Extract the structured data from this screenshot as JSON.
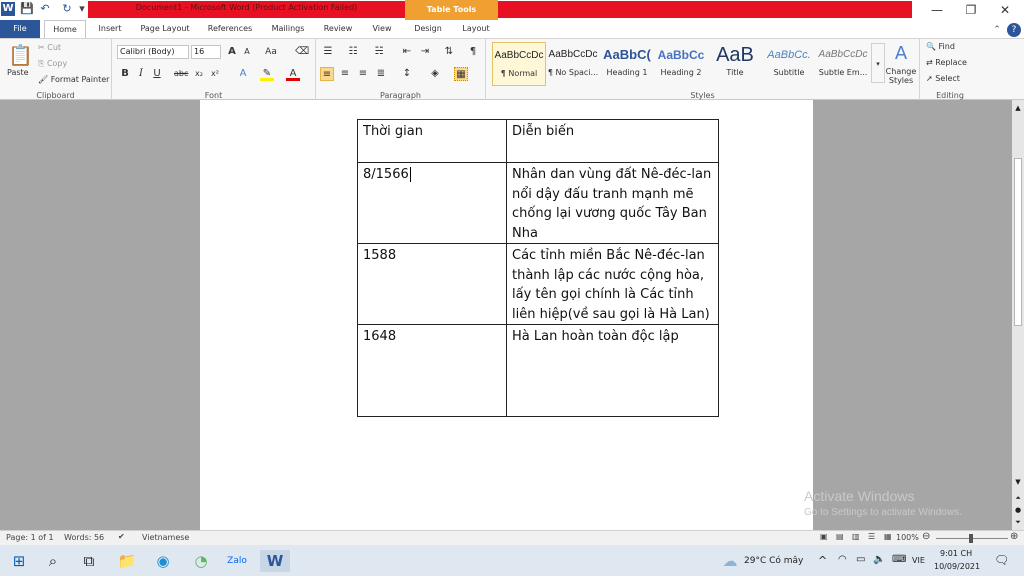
{
  "window": {
    "title": "Document1 - Microsoft Word (Product Activation Failed)",
    "context_tab": "Table Tools",
    "minimize": "—",
    "restore": "❐",
    "close": "✕"
  },
  "quick_access": {
    "app_icon": "W",
    "save": "💾",
    "undo": "↶",
    "redo": "↻",
    "customize": "▾"
  },
  "tabs": [
    "File",
    "Home",
    "Insert",
    "Page Layout",
    "References",
    "Mailings",
    "Review",
    "View",
    "Design",
    "Layout"
  ],
  "ribbon": {
    "clipboard": {
      "label": "Clipboard",
      "paste": "Paste",
      "cut": "Cut",
      "copy": "Copy",
      "format_painter": "Format Painter"
    },
    "font": {
      "label": "Font",
      "name": "Calibri (Body)",
      "size": "16"
    },
    "paragraph": {
      "label": "Paragraph"
    },
    "styles": {
      "label": "Styles",
      "items": [
        {
          "preview": "AaBbCcDc",
          "name": "¶ Normal"
        },
        {
          "preview": "AaBbCcDc",
          "name": "¶ No Spaci..."
        },
        {
          "preview": "AaBbC(",
          "name": "Heading 1"
        },
        {
          "preview": "AaBbCc",
          "name": "Heading 2"
        },
        {
          "preview": "AaB",
          "name": "Title"
        },
        {
          "preview": "AaBbCc.",
          "name": "Subtitle"
        },
        {
          "preview": "AaBbCcDc",
          "name": "Subtle Em..."
        }
      ],
      "change_styles": "Change Styles"
    },
    "editing": {
      "label": "Editing",
      "find": "Find",
      "replace": "Replace",
      "select": "Select"
    }
  },
  "table": {
    "rows": [
      [
        "Thời gian",
        "Diễn biến"
      ],
      [
        "8/1566",
        "Nhân dan vùng đất Nê-đéc-lan nổi dậy đấu tranh mạnh mẽ chống lại vương quốc Tây Ban Nha"
      ],
      [
        "1588",
        "Các tỉnh miền Bắc Nê-đéc-lan thành lập các nước cộng hòa, lấy tên gọi chính là Các tỉnh liên hiệp(về sau gọi là Hà Lan)"
      ],
      [
        "1648",
        "Hà Lan hoàn toàn độc lập"
      ]
    ]
  },
  "watermark": {
    "line1": "Activate Windows",
    "line2": "Go to Settings to activate Windows."
  },
  "status": {
    "page": "Page: 1 of 1",
    "words": "Words: 56",
    "language": "Vietnamese",
    "zoom": "100%"
  },
  "taskbar": {
    "weather": "29°C  Có mây",
    "lang": "VIE",
    "time": "9:01 CH",
    "date": "10/09/2021"
  }
}
